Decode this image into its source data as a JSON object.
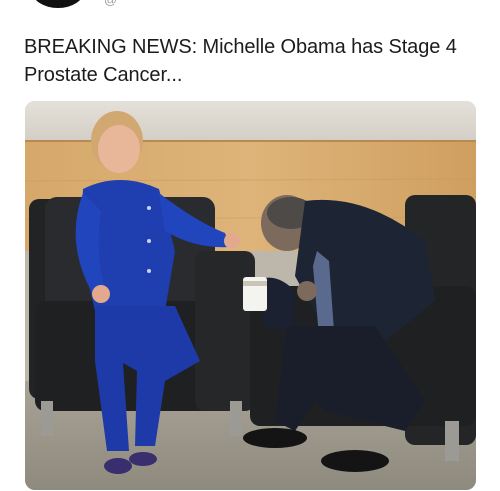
{
  "tweet": {
    "handle_fragment": "@",
    "text": "BREAKING NEWS:  Michelle Obama has Stage 4 Prostate Cancer..."
  },
  "media": {
    "icon": "photo"
  }
}
